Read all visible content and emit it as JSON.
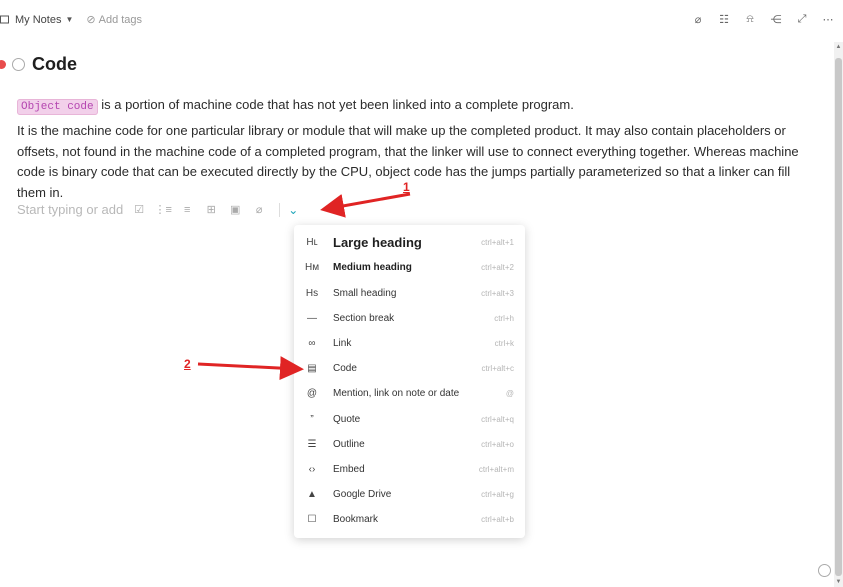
{
  "header": {
    "notebook": "My Notes",
    "tags_placeholder": "Add tags",
    "icons": [
      "paperclip-icon",
      "checklist-icon",
      "bell-icon",
      "share-icon",
      "expand-icon",
      "more-icon"
    ]
  },
  "note": {
    "title": "Code",
    "code_chip": "Object code",
    "para1_rest": " is a portion of machine code that has not yet been linked into a complete program.",
    "para2": "It is the machine code for one particular library or module that will make up the completed product. It may also contain placeholders or offsets, not found in the machine code of a completed program, that the linker will use to connect everything together. Whereas machine code is binary code that can be executed directly by the CPU, object code has the jumps partially parameterized so that a linker can fill them in.",
    "placeholder": "Start typing or add"
  },
  "menu": {
    "items": [
      {
        "icon": "Hʟ",
        "label": "Large heading",
        "shortcut": "ctrl+alt+1"
      },
      {
        "icon": "Hм",
        "label": "Medium heading",
        "shortcut": "ctrl+alt+2"
      },
      {
        "icon": "Hѕ",
        "label": "Small heading",
        "shortcut": "ctrl+alt+3"
      },
      {
        "icon": "—",
        "label": "Section break",
        "shortcut": "ctrl+h"
      },
      {
        "icon": "∞",
        "label": "Link",
        "shortcut": "ctrl+k"
      },
      {
        "icon": "▤",
        "label": "Code",
        "shortcut": "ctrl+alt+c"
      },
      {
        "icon": "@",
        "label": "Mention, link on note or date",
        "shortcut": "@"
      },
      {
        "icon": "”",
        "label": "Quote",
        "shortcut": "ctrl+alt+q"
      },
      {
        "icon": "☰",
        "label": "Outline",
        "shortcut": "ctrl+alt+o"
      },
      {
        "icon": "‹›",
        "label": "Embed",
        "shortcut": "ctrl+alt+m"
      },
      {
        "icon": "▲",
        "label": "Google Drive",
        "shortcut": "ctrl+alt+g"
      },
      {
        "icon": "☐",
        "label": "Bookmark",
        "shortcut": "ctrl+alt+b"
      }
    ]
  },
  "annotations": {
    "one": "1",
    "two": "2"
  },
  "colors": {
    "accent": "#1aa3b8",
    "annotation": "#e02424",
    "code_chip": "#f2d0ea"
  }
}
